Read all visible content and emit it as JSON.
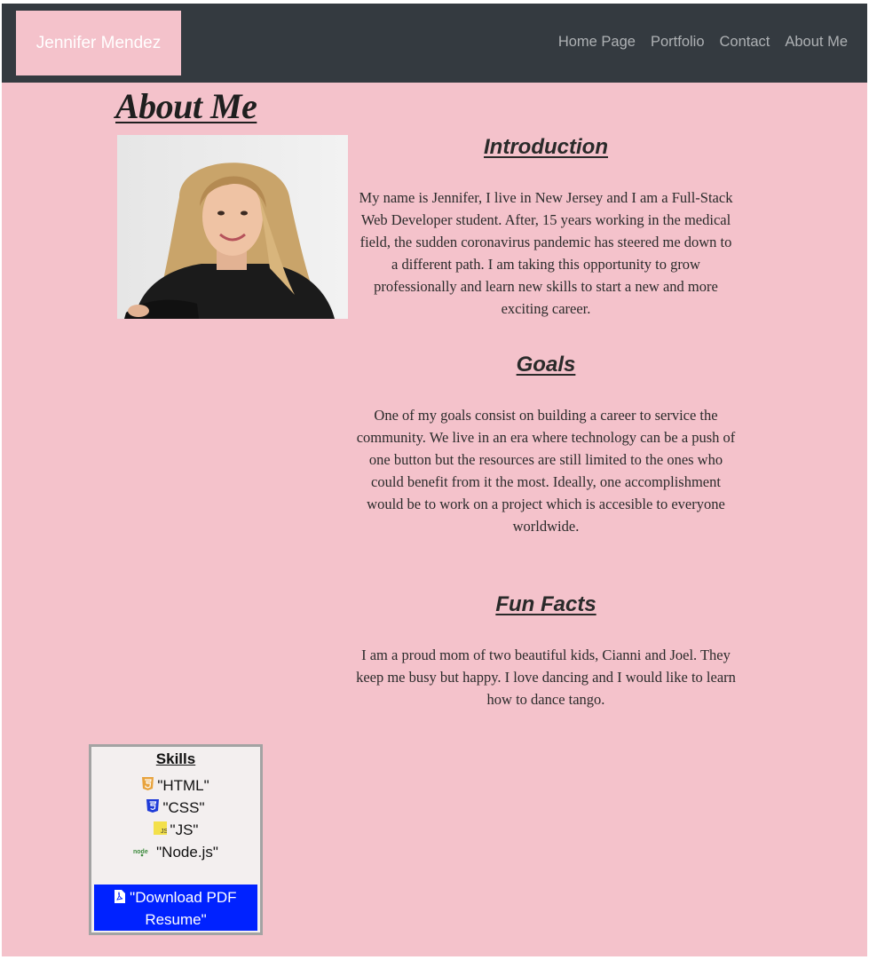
{
  "navbar": {
    "brand": "Jennifer Mendez",
    "links": [
      "Home Page",
      "Portfolio",
      "Contact",
      "About Me"
    ]
  },
  "page": {
    "title": "About Me"
  },
  "sections": {
    "introduction": {
      "heading": "Introduction",
      "text": "My name is Jennifer, I live in New Jersey and I am a Full-Stack Web Developer student. After, 15 years working in the medical field, the sudden coronavirus pandemic has steered me down to a different path. I am taking this opportunity to grow professionally and learn new skills to start a new and more exciting career."
    },
    "goals": {
      "heading": "Goals",
      "text": "One of my goals consist on building a career to service the community. We live in an era where technology can be a push of one button but the resources are still limited to the ones who could benefit from it the most. Ideally, one accomplishment would be to work on a project which is accesible to everyone worldwide."
    },
    "fun_facts": {
      "heading": "Fun Facts",
      "text": "I am a proud mom of two beautiful kids, Cianni and Joel. They keep me busy but happy. I love dancing and I would like to learn how to dance tango."
    }
  },
  "skills": {
    "title": "Skills",
    "items": [
      {
        "label": "\"HTML\"",
        "icon": "html5-icon",
        "color": "#e8a33d"
      },
      {
        "label": "\"CSS\"",
        "icon": "css3-icon",
        "color": "#1f3bd8"
      },
      {
        "label": "\"JS\"",
        "icon": "js-icon",
        "color": "#f3e04a"
      },
      {
        "label": "\"Node.js\"",
        "icon": "nodejs-icon",
        "color": "#3c8a3c"
      }
    ],
    "resume_button": "\"Download PDF Resume\""
  },
  "colors": {
    "background": "#f4c2cb",
    "navbar": "#343a40",
    "button": "#0022ff"
  }
}
